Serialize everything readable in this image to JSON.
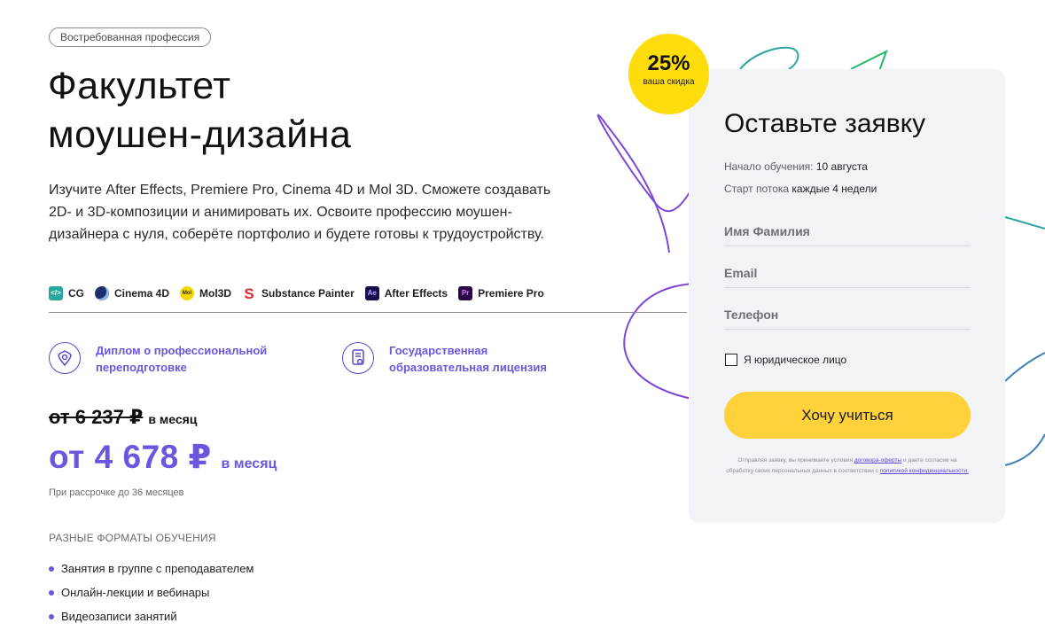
{
  "hero": {
    "tag": "Востребованная профессия",
    "title_line1": "Факультет",
    "title_line2": "моушен-дизайна",
    "description": "Изучите After Effects, Premiere Pro, Cinema 4D и Mol 3D. Сможете создавать 2D- и 3D-композиции и анимировать их. Освоите профессию моушен-дизайнера с нуля, соберёте портфолио и будете готовы к трудоустройству."
  },
  "tools": [
    {
      "label": "CG",
      "icon": "cg-icon",
      "icon_text": "</>"
    },
    {
      "label": "Cinema 4D",
      "icon": "cinema-4d-icon",
      "icon_text": ""
    },
    {
      "label": "Mol3D",
      "icon": "mol3d-icon",
      "icon_text": "Mol"
    },
    {
      "label": "Substance Painter",
      "icon": "substance-painter-icon",
      "icon_text": "S"
    },
    {
      "label": "After Effects",
      "icon": "after-effects-icon",
      "icon_text": "Ae"
    },
    {
      "label": "Premiere Pro",
      "icon": "premiere-pro-icon",
      "icon_text": "Pr"
    }
  ],
  "features": [
    {
      "label": "Диплом о профессиональной переподготовке",
      "icon": "emblem-icon"
    },
    {
      "label": "Государственная образовательная лицензия",
      "icon": "certificate-icon"
    }
  ],
  "pricing": {
    "old_price": "от 6 237 ₽",
    "old_unit": "в месяц",
    "new_price": "от 4 678 ₽",
    "new_unit": "в месяц",
    "installment": "При рассрочке до 36 месяцев"
  },
  "formats": {
    "heading": "РАЗНЫЕ ФОРМАТЫ ОБУЧЕНИЯ",
    "items": [
      "Занятия в группе с преподавателем",
      "Онлайн-лекции и вебинары",
      "Видеозаписи занятий"
    ]
  },
  "badge": {
    "value": "25%",
    "caption": "ваша скидка"
  },
  "form": {
    "title": "Оставьте заявку",
    "start_label": "Начало обучения:",
    "start_value": "10 августа",
    "stream_label": "Старт потока",
    "stream_value": "каждые 4 недели",
    "name_placeholder": "Имя Фамилия",
    "email_placeholder": "Email",
    "phone_placeholder": "Телефон",
    "checkbox_label": "Я юридическое лицо",
    "submit_label": "Хочу учиться",
    "legal_text_1": "Отправляя заявку, вы принимаете условия",
    "legal_link_1": "договора-оферты",
    "legal_text_2": "и даете согласие на обработку своих персональных данных в соответствии с",
    "legal_link_2": "политикой конфиденциальности."
  },
  "colors": {
    "accent": "#6a57de",
    "badge": "#ffdd0c",
    "button": "#ffd23c",
    "card": "#f2f3f7"
  }
}
